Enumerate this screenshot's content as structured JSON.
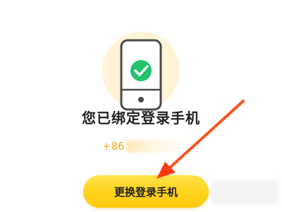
{
  "bind_status": {
    "title": "您已绑定登录手机",
    "phone_visible": "+86"
  },
  "actions": {
    "change_phone_label": "更换登录手机"
  },
  "icons": {
    "phone_illustration": "phone-with-check-icon",
    "check": "check-circle-icon",
    "annotation": "red-arrow-icon"
  },
  "colors": {
    "accent_yellow": "#ffd21a",
    "check_green": "#22c36b",
    "phone_text": "#f2a72a",
    "arrow_red": "#ff4a1c"
  }
}
